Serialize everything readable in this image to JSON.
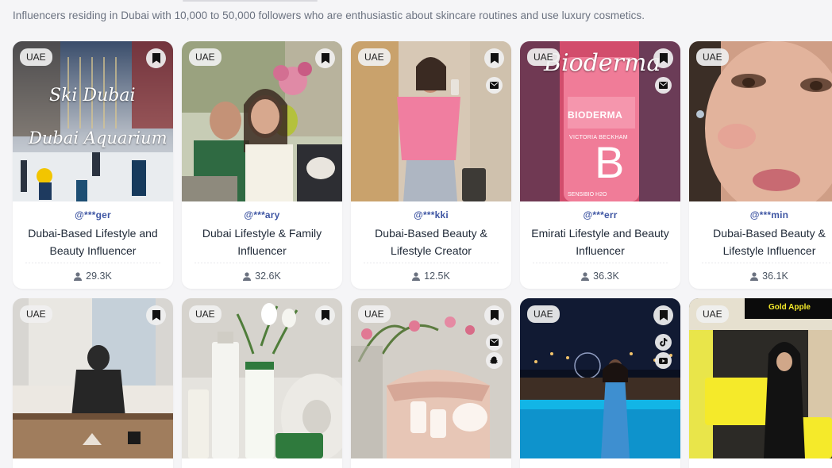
{
  "query": "Influencers residing in Dubai with 10,000 to 50,000 followers who are enthusiastic about skincare routines and use luxury cosmetics.",
  "cards": [
    {
      "country": "UAE",
      "handle": "@***ger",
      "title": "Dubai-Based Lifestyle and Beauty Influencer",
      "followers": "29.3K",
      "overlay": [
        "Ski Dubai",
        "Dubai Aquarium"
      ],
      "side_buttons": []
    },
    {
      "country": "UAE",
      "handle": "@***ary",
      "title": "Dubai Lifestyle & Family Influencer",
      "followers": "32.6K",
      "overlay": [],
      "side_buttons": []
    },
    {
      "country": "UAE",
      "handle": "@***kki",
      "title": "Dubai-Based Beauty & Lifestyle Creator",
      "followers": "12.5K",
      "overlay": [],
      "side_buttons": [
        "email-icon"
      ]
    },
    {
      "country": "UAE",
      "handle": "@***err",
      "title": "Emirati Lifestyle and Beauty Influencer",
      "followers": "36.3K",
      "overlay": [
        "Bioderma",
        "BIODERMA",
        "VICTORIA BECKHAM",
        "B",
        "SENSIBIO H2O"
      ],
      "side_buttons": [
        "email-icon"
      ]
    },
    {
      "country": "UAE",
      "handle": "@***min",
      "title": "Dubai-Based Beauty & Lifestyle Influencer",
      "followers": "36.1K",
      "overlay": [],
      "side_buttons": []
    },
    {
      "country": "UAE",
      "side_buttons": []
    },
    {
      "country": "UAE",
      "side_buttons": []
    },
    {
      "country": "UAE",
      "side_buttons": [
        "email-icon",
        "snapchat-icon"
      ]
    },
    {
      "country": "UAE",
      "side_buttons": [
        "tiktok-icon",
        "youtube-icon"
      ]
    },
    {
      "country": "UAE",
      "overlay": [
        "Gold Apple"
      ],
      "side_buttons": []
    }
  ],
  "colors": {
    "accent": "#3f56a3",
    "background": "#f5f5f7"
  }
}
